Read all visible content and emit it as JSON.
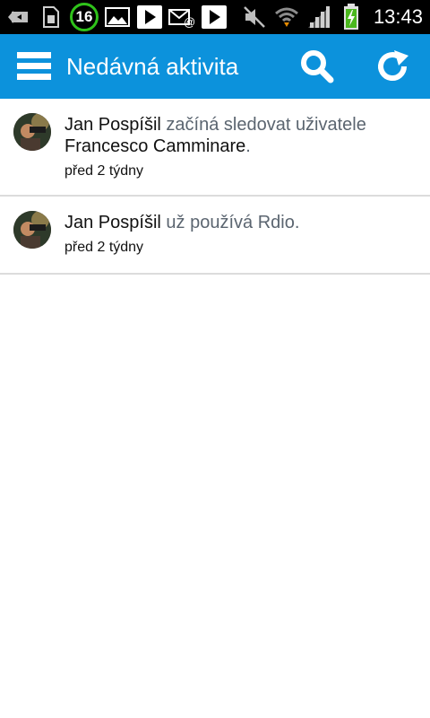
{
  "statusbar": {
    "notification_count": "16",
    "time": "13:43",
    "icons": [
      "back-arrow-icon",
      "sim-card-icon",
      "notification-count-badge",
      "image-icon",
      "play-store-icon",
      "email-icon",
      "play-store-icon",
      "mute-icon",
      "wifi-icon",
      "signal-icon",
      "battery-charging-icon"
    ]
  },
  "actionbar": {
    "title": "Nedávná aktivita",
    "color": "#0c92dc",
    "menu_icon": "hamburger-icon",
    "search_icon": "search-icon",
    "refresh_icon": "refresh-icon"
  },
  "feed": [
    {
      "user": "Jan Pospíšil",
      "action": "začíná sledovat uživatele",
      "target": "Francesco Camminare",
      "end": ".",
      "time": "před 2 týdny"
    },
    {
      "user": "Jan Pospíšil",
      "action": "už používá Rdio.",
      "time": "před 2 týdny"
    }
  ]
}
